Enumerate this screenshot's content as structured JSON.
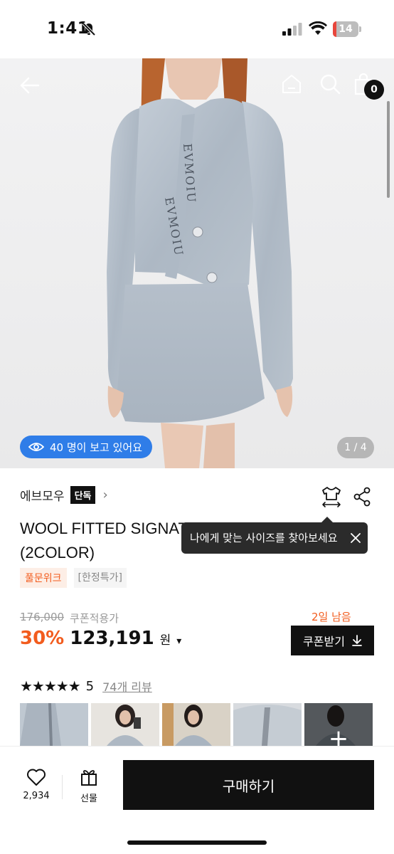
{
  "status_bar": {
    "time": "1:41",
    "battery": "14",
    "battery_level": 0.14
  },
  "hero": {
    "viewers_text": "40 명이 보고 있어요",
    "page_count": "1 / 4",
    "cart_count": "0"
  },
  "product": {
    "brand": "에브모우",
    "brand_tag": "단독",
    "title": "WOOL FITTED SIGNATURE CARDIGAN (2COLOR)",
    "tags": [
      "풀문위크",
      "[한정특가]"
    ],
    "original_price": "176,000",
    "coupon_label": "쿠폰적용가",
    "days_left": "2일 남음",
    "discount": "30%",
    "price": "123,191",
    "currency": "원",
    "coupon_button": "쿠폰받기",
    "rating": "5",
    "rating_value": 5,
    "review_link": "74개 리뷰",
    "more_photos_icon": "+"
  },
  "tooltip": {
    "text": "나에게 맞는 사이즈를 찾아보세요"
  },
  "bottom_bar": {
    "like_count": "2,934",
    "gift_label": "선물",
    "buy_label": "구매하기"
  },
  "colors": {
    "accent_orange": "#f25c1e",
    "accent_blue": "#2f7de8",
    "black": "#111111",
    "knit_blue_gray": "#b4bec9"
  },
  "icons": [
    "back-arrow-icon",
    "home-icon",
    "search-icon",
    "cart-icon",
    "eye-icon",
    "size-guide-icon",
    "share-icon",
    "close-icon",
    "download-icon",
    "heart-icon",
    "gift-icon",
    "chevron-right-icon",
    "chevron-down-icon",
    "star-icon",
    "plus-icon"
  ]
}
